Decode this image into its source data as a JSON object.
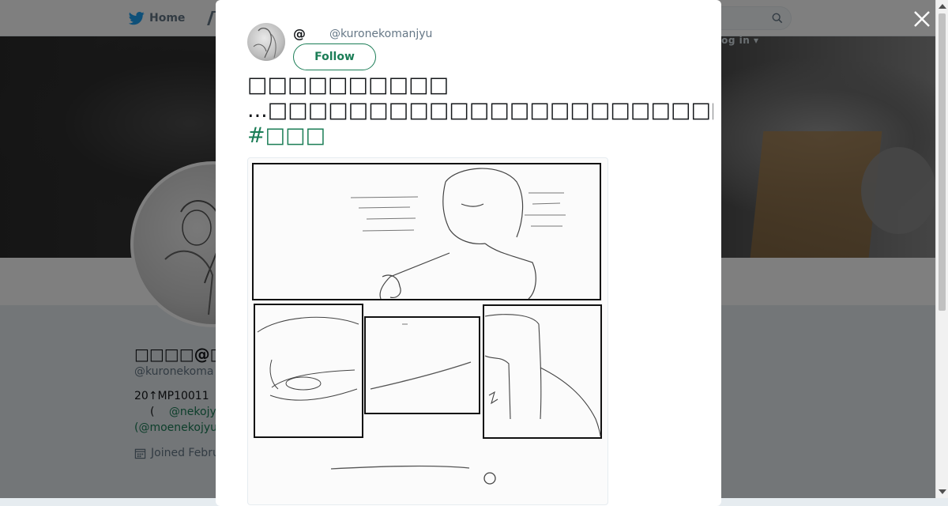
{
  "nav": {
    "home_label": "Home",
    "login_label": "Log in ▾",
    "icons": [
      "twitter-bird-icon",
      "moments-icon",
      "search-icon"
    ]
  },
  "profile": {
    "name": "□□□□@□□□",
    "handle": "@kuronekoma",
    "bio_line1": "20↑MP10011",
    "bio_line2_prefix": "(",
    "bio_line2_link": "@nekojy",
    "bio_line3_link": "(@moenekojyu",
    "joined": "Joined Febru"
  },
  "tweet": {
    "author_name": "@",
    "author_handle": "@kuronekomanjyu",
    "follow_label": "Follow",
    "text_line1": "□□□□□□□□□□",
    "text_line2": "...□□□□□□□□□□□□□□□□□□□□□□□□□□□□□□□□□□□□□□□□□□□□□□□",
    "hashtag": "#□□□"
  },
  "colors": {
    "accent": "#1b7d56",
    "text_primary": "#14171a",
    "text_secondary": "#657786",
    "overlay": "rgba(0,0,0,0.5)",
    "twitter_blue": "#1da1f2"
  }
}
